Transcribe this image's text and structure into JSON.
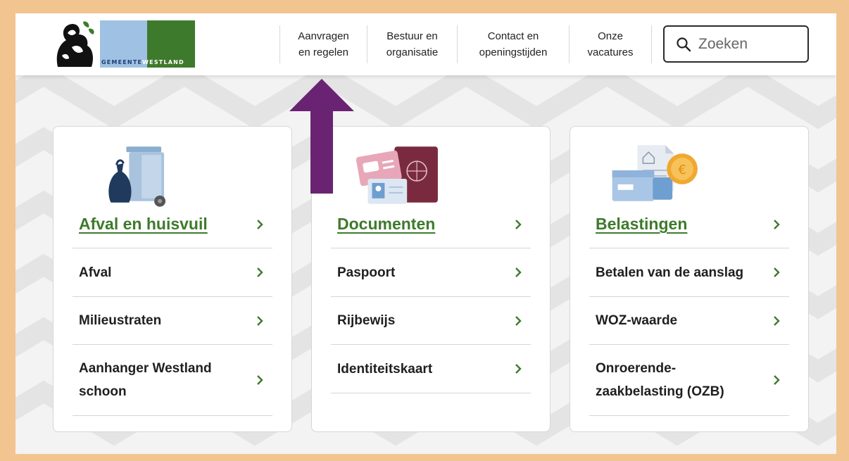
{
  "brand": {
    "wordmark_part1": "GEMEENTE",
    "wordmark_part2": "WESTLAND",
    "colors": {
      "green": "#3e7a2c",
      "blue": "#9fc1e3",
      "border": "#f2c48f",
      "arrow": "#6a2372"
    }
  },
  "nav": {
    "items": [
      {
        "label": "Aanvragen\nen regelen"
      },
      {
        "label": "Bestuur en\norganisatie"
      },
      {
        "label": "Contact en\nopeningstijden"
      },
      {
        "label": "Onze\nvacatures"
      }
    ]
  },
  "search": {
    "placeholder": "Zoeken",
    "icon": "search-icon"
  },
  "cards": [
    {
      "icon": "waste-bin-icon",
      "title": "Afval en huisvuil",
      "links": [
        "Afval",
        "Milieustraten",
        "Aanhanger Westland schoon"
      ]
    },
    {
      "icon": "documents-icon",
      "title": "Documenten",
      "links": [
        "Paspoort",
        "Rijbewijs",
        "Identiteitskaart"
      ]
    },
    {
      "icon": "taxes-icon",
      "title": "Belastingen",
      "links": [
        "Betalen van de aanslag",
        "WOZ-waarde",
        "Onroerende-zaakbelasting (OZB)"
      ]
    }
  ]
}
